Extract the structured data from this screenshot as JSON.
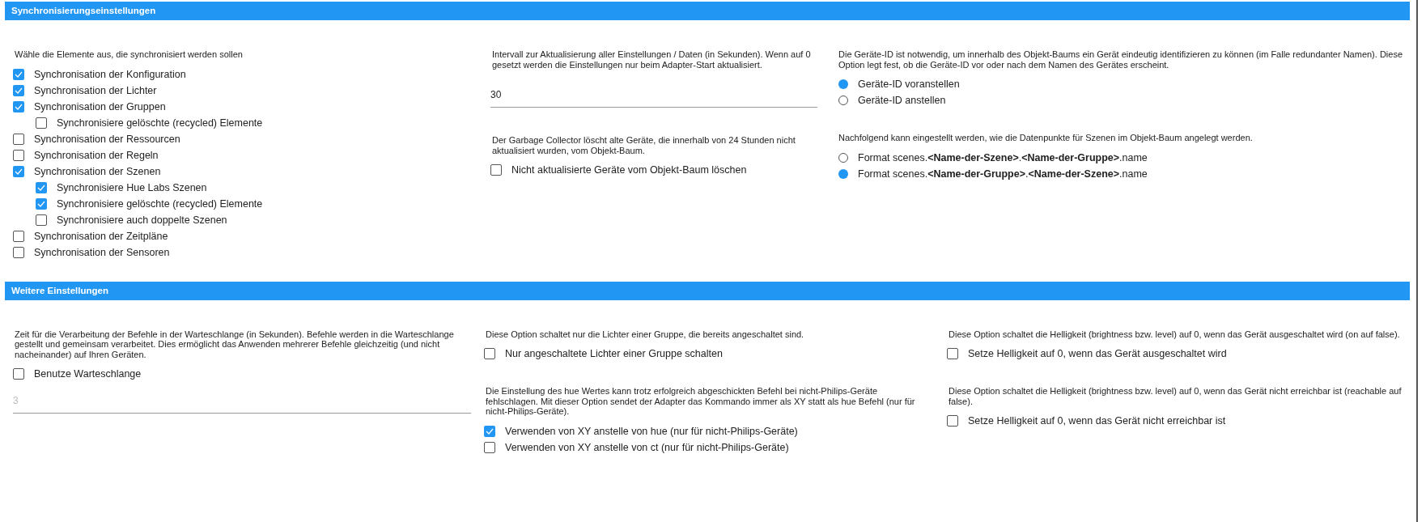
{
  "sections": [
    {
      "title": "Synchronisierungseinstellungen",
      "columns": [
        {
          "blocks": [
            {
              "kind": "note",
              "text": "Wähle die Elemente aus, die synchronisiert werden sollen"
            },
            {
              "kind": "checkboxes",
              "items": [
                {
                  "label": "Synchronisation der Konfiguration",
                  "checked": true
                },
                {
                  "label": "Synchronisation der Lichter",
                  "checked": true
                },
                {
                  "label": "Synchronisation der Gruppen",
                  "checked": true,
                  "children": [
                    {
                      "label": "Synchronisiere gelöschte (recycled) Elemente",
                      "checked": false
                    }
                  ]
                },
                {
                  "label": "Synchronisation der Ressourcen",
                  "checked": false
                },
                {
                  "label": "Synchronisation der Regeln",
                  "checked": false
                },
                {
                  "label": "Synchronisation der Szenen",
                  "checked": true,
                  "children": [
                    {
                      "label": "Synchronisiere Hue Labs Szenen",
                      "checked": true
                    },
                    {
                      "label": "Synchronisiere gelöschte (recycled) Elemente",
                      "checked": true
                    },
                    {
                      "label": "Synchronisiere auch doppelte Szenen",
                      "checked": false
                    }
                  ]
                },
                {
                  "label": "Synchronisation der Zeitpläne",
                  "checked": false
                },
                {
                  "label": "Synchronisation der Sensoren",
                  "checked": false
                }
              ]
            }
          ]
        },
        {
          "blocks": [
            {
              "kind": "note",
              "text": "Intervall zur Aktualisierung aller Einstellungen / Daten (in Sekunden). Wenn auf 0 gesetzt werden die Einstellungen nur beim Adapter-Start aktualisiert."
            },
            {
              "kind": "input",
              "value": "30",
              "disabled": false
            },
            {
              "kind": "note",
              "text": "Der Garbage Collector löscht alte Geräte, die innerhalb von 24 Stunden nicht aktualisiert wurden, vom Objekt-Baum."
            },
            {
              "kind": "checkboxes",
              "items": [
                {
                  "label": "Nicht aktualisierte Geräte vom Objekt-Baum löschen",
                  "checked": false
                }
              ]
            }
          ]
        },
        {
          "blocks": [
            {
              "kind": "note",
              "text": "Die Geräte-ID ist notwendig, um innerhalb des Objekt-Baums ein Gerät eindeutig identifizieren zu können (im Falle redundanter Namen). Diese Option legt fest, ob die Geräte-ID vor oder nach dem Namen des Gerätes erscheint."
            },
            {
              "kind": "radios",
              "items": [
                {
                  "label": "Geräte-ID voranstellen",
                  "selected": true
                },
                {
                  "label": "Geräte-ID anstellen",
                  "selected": false
                }
              ]
            },
            {
              "kind": "note",
              "text": "Nachfolgend kann eingestellt werden, wie die Datenpunkte für Szenen im Objekt-Baum angelegt werden."
            },
            {
              "kind": "radios",
              "items": [
                {
                  "label": "Format scenes.**<Name-der-Szene>**.**<Name-der-Gruppe>**.name",
                  "selected": false
                },
                {
                  "label": "Format scenes.**<Name-der-Gruppe>**.**<Name-der-Szene>**.name",
                  "selected": true
                }
              ]
            }
          ]
        }
      ]
    },
    {
      "title": "Weitere Einstellungen",
      "columns": [
        {
          "blocks": [
            {
              "kind": "note",
              "text": "Zeit für die Verarbeitung der Befehle in der Warteschlange (in Sekunden). Befehle werden in die Warteschlange gestellt und gemeinsam verarbeitet. Dies ermöglicht das Anwenden mehrerer Befehle gleichzeitig (und nicht nacheinander) auf Ihren Geräten."
            },
            {
              "kind": "checkboxes",
              "items": [
                {
                  "label": "Benutze Warteschlange",
                  "checked": false
                }
              ]
            },
            {
              "kind": "input",
              "value": "3",
              "disabled": true
            }
          ]
        },
        {
          "blocks": [
            {
              "kind": "note",
              "text": "Diese Option schaltet nur die Lichter einer Gruppe, die bereits angeschaltet sind."
            },
            {
              "kind": "checkboxes",
              "items": [
                {
                  "label": "Nur angeschaltete Lichter einer Gruppe schalten",
                  "checked": false
                }
              ]
            },
            {
              "kind": "note",
              "text": "Die Einstellung des hue Wertes kann trotz erfolgreich abgeschickten Befehl bei nicht-Philips-Geräte fehlschlagen. Mit dieser Option sendet der Adapter das Kommando immer als XY statt als hue Befehl (nur für nicht-Philips-Geräte)."
            },
            {
              "kind": "checkboxes",
              "items": [
                {
                  "label": "Verwenden von XY anstelle von hue (nur für nicht-Philips-Geräte)",
                  "checked": true
                },
                {
                  "label": "Verwenden von XY anstelle von ct (nur für nicht-Philips-Geräte)",
                  "checked": false
                }
              ]
            }
          ]
        },
        {
          "blocks": [
            {
              "kind": "note",
              "text": "Diese Option schaltet die Helligkeit (brightness bzw. level) auf 0, wenn das Gerät ausgeschaltet wird (on auf false)."
            },
            {
              "kind": "checkboxes",
              "items": [
                {
                  "label": "Setze Helligkeit auf 0, wenn das Gerät ausgeschaltet wird",
                  "checked": false
                }
              ]
            },
            {
              "kind": "note",
              "text": "Diese Option schaltet die Helligkeit (brightness bzw. level) auf 0, wenn das Gerät nicht erreichbar ist (reachable auf false)."
            },
            {
              "kind": "checkboxes",
              "items": [
                {
                  "label": "Setze Helligkeit auf 0, wenn das Gerät nicht erreichbar ist",
                  "checked": false
                }
              ]
            }
          ]
        }
      ]
    }
  ]
}
